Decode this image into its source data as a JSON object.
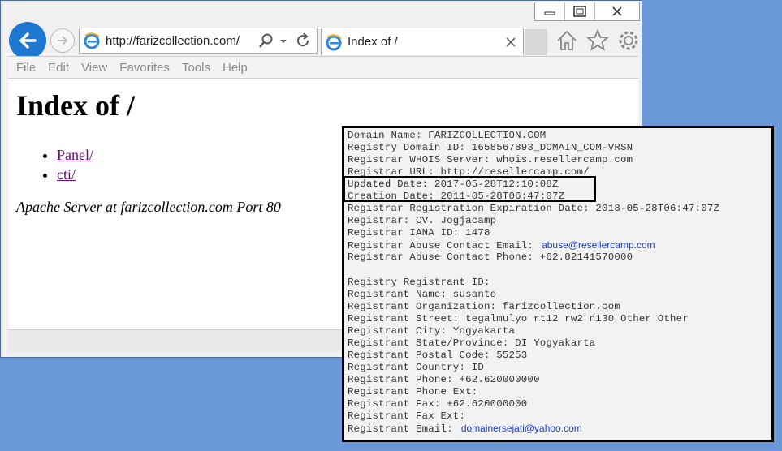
{
  "browser": {
    "url": "http://farizcollection.com/",
    "tab_title": "Index of /",
    "menu": [
      "File",
      "Edit",
      "View",
      "Favorites",
      "Tools",
      "Help"
    ]
  },
  "page": {
    "heading": "Index of /",
    "links": [
      "Panel/",
      "cti/"
    ],
    "footer": "Apache Server at farizcollection.com Port 80"
  },
  "whois": {
    "lines": [
      "Domain Name: FARIZCOLLECTION.COM",
      "Registry Domain ID: 1658567893_DOMAIN_COM-VRSN",
      "Registrar WHOIS Server: whois.resellercamp.com",
      "Registrar URL: http://resellercamp.com/",
      "Updated Date: 2017-05-28T12:10:08Z",
      "Creation Date: 2011-05-28T06:47:07Z",
      "Registrar Registration Expiration Date: 2018-05-28T06:47:07Z",
      "Registrar: CV. Jogjacamp",
      "Registrar IANA ID: 1478",
      "Registrar Abuse Contact Email:",
      "Registrar Abuse Contact Phone: +62.82141570000",
      "",
      "Registry Registrant ID:",
      "Registrant Name: susanto",
      "Registrant Organization: farizcollection.com",
      "Registrant Street: tegalmulyo rt12 rw2 n130 Other Other",
      "Registrant City: Yogyakarta",
      "Registrant State/Province: DI Yogyakarta",
      "Registrant Postal Code: 55253",
      "Registrant Country: ID",
      "Registrant Phone: +62.620000000",
      "Registrant Phone Ext:",
      "Registrant Fax: +62.620000000",
      "Registrant Fax Ext:",
      "Registrant Email:"
    ],
    "abuse_email": "abuse@resellercamp.com",
    "registrant_email": "domainersejati@yahoo.com"
  },
  "colors": {
    "back_button": "#1e78d2",
    "link_visited": "#660e7a",
    "email_link": "#1e3ec8",
    "desktop": "#6a98d8"
  },
  "icons": [
    "back-arrow-icon",
    "forward-arrow-icon",
    "ie-logo-icon",
    "search-icon",
    "dropdown-icon",
    "refresh-icon",
    "close-tab-icon",
    "home-icon",
    "favorites-star-icon",
    "settings-gear-icon",
    "minimize-icon",
    "maximize-icon",
    "close-icon"
  ]
}
